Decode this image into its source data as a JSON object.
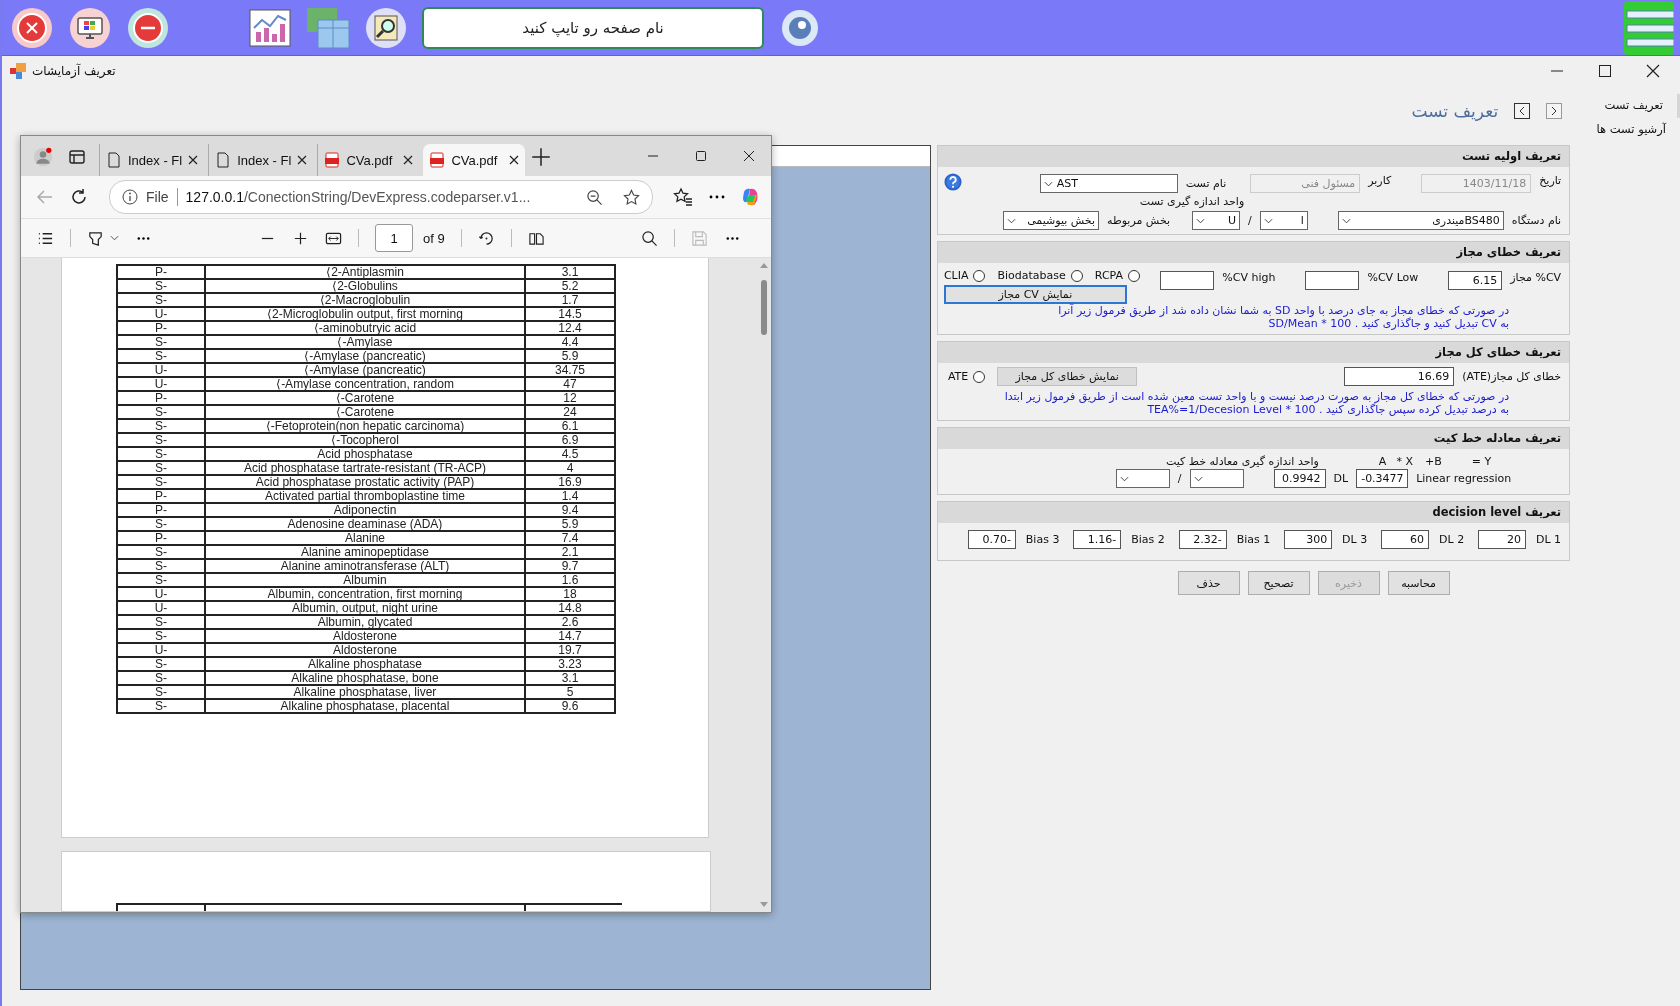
{
  "top_bar": {
    "search": {
      "placeholder": "نام صفحه رو تایپ کنید"
    }
  },
  "window": {
    "title": "تعریف آزمایشات"
  },
  "sidebar": {
    "items": [
      {
        "label": "تعریف تست",
        "selected": true
      },
      {
        "label": "آرشیو تست ها",
        "selected": false
      }
    ]
  },
  "page_title": "تعریف تست",
  "browser": {
    "tabs": [
      {
        "label": "Index - Fl",
        "kind": "page",
        "selected": false
      },
      {
        "label": "Index - Fl",
        "kind": "page",
        "selected": false
      },
      {
        "label": "CVa.pdf",
        "kind": "pdf",
        "selected": false
      },
      {
        "label": "CVa.pdf",
        "kind": "pdf",
        "selected": true
      }
    ],
    "address": {
      "scheme": "File",
      "host": "127.0.0.1",
      "path": "/ConectionString/DevExpress.codeparser.v1..."
    },
    "pdf_toolbar": {
      "page": "1",
      "page_count": "of 9"
    },
    "table": {
      "rows": [
        {
          "type": "P-",
          "name": "⟨2-Antiplasmin",
          "value": "3.1"
        },
        {
          "type": "S-",
          "name": "⟨2-Globulins",
          "value": "5.2"
        },
        {
          "type": "S-",
          "name": "⟨2-Macroglobulin",
          "value": "1.7"
        },
        {
          "type": "U-",
          "name": "⟨2-Microglobulin output, first morning",
          "value": "14.5"
        },
        {
          "type": "P-",
          "name": "⟨-aminobutryic acid",
          "value": "12.4"
        },
        {
          "type": "S-",
          "name": "⟨-Amylase",
          "value": "4.4"
        },
        {
          "type": "S-",
          "name": "⟨-Amylase (pancreatic)",
          "value": "5.9"
        },
        {
          "type": "U-",
          "name": "⟨-Amylase (pancreatic)",
          "value": "34.75"
        },
        {
          "type": "U-",
          "name": "⟨-Amylase concentration, random",
          "value": "47"
        },
        {
          "type": "P-",
          "name": "⟨-Carotene",
          "value": "12"
        },
        {
          "type": "S-",
          "name": "⟨-Carotene",
          "value": "24"
        },
        {
          "type": "S-",
          "name": "⟨-Fetoprotein(non hepatic carcinoma)",
          "value": "6.1"
        },
        {
          "type": "S-",
          "name": "⟨-Tocopherol",
          "value": "6.9"
        },
        {
          "type": "S-",
          "name": "Acid phosphatase",
          "value": "4.5"
        },
        {
          "type": "S-",
          "name": "Acid phosphatase tartrate-resistant (TR-ACP)",
          "value": "4"
        },
        {
          "type": "S-",
          "name": "Acid phosphatase prostatic activity (PAP)",
          "value": "16.9"
        },
        {
          "type": "P-",
          "name": "Activated partial thromboplastine time",
          "value": "1.4"
        },
        {
          "type": "P-",
          "name": "Adiponectin",
          "value": "9.4"
        },
        {
          "type": "S-",
          "name": "Adenosine deaminase (ADA)",
          "value": "5.9"
        },
        {
          "type": "P-",
          "name": "Alanine",
          "value": "7.4"
        },
        {
          "type": "S-",
          "name": "Alanine aminopeptidase",
          "value": "2.1"
        },
        {
          "type": "S-",
          "name": "Alanine aminotransferase (ALT)",
          "value": "9.7"
        },
        {
          "type": "S-",
          "name": "Albumin",
          "value": "1.6"
        },
        {
          "type": "U-",
          "name": "Albumin, concentration, first morning",
          "value": "18"
        },
        {
          "type": "U-",
          "name": "Albumin, output, night urine",
          "value": "14.8"
        },
        {
          "type": "S-",
          "name": "Albumin, glycated",
          "value": "2.6"
        },
        {
          "type": "S-",
          "name": "Aldosterone",
          "value": "14.7"
        },
        {
          "type": "U-",
          "name": "Aldosterone",
          "value": "19.7"
        },
        {
          "type": "S-",
          "name": "Alkaline phosphatase",
          "value": "3.23"
        },
        {
          "type": "S-",
          "name": "Alkaline phosphatase, bone",
          "value": "3.1"
        },
        {
          "type": "S-",
          "name": "Alkaline phosphatase, liver",
          "value": "5"
        },
        {
          "type": "S-",
          "name": "Alkaline phosphatase, placental",
          "value": "9.6"
        }
      ]
    }
  },
  "basic": {
    "title": "تعریف اولیه تست",
    "date": {
      "label": "تاریخ",
      "value": "1403/11/18",
      "disabled": true
    },
    "user": {
      "label": "کاربر",
      "value": "مسئول فنی",
      "disabled": true
    },
    "test_name": {
      "label": "نام تست",
      "value": "AST"
    },
    "unit_label": "واحد اندازه گیری تست",
    "device": {
      "label": "نام دستگاه",
      "value": "BS480میندری"
    },
    "unit_1": "l",
    "unit_separator": "/",
    "unit_2": "U",
    "department": {
      "label": "بخش مربوطه",
      "value": "بخش بیوشیمی"
    }
  },
  "allowed_error": {
    "title": "تعریف خطای مجاز",
    "cv": {
      "label": "CV% مجاز",
      "value": "6.15"
    },
    "cv_low_label": "CV Low%",
    "cv_high_label": "CV high%",
    "options": [
      {
        "label": "CLIA",
        "selected": false
      },
      {
        "label": "Biodatabase",
        "selected": false
      },
      {
        "label": "RCPA",
        "selected": false
      }
    ],
    "show_button": "نمایش CV مجاز",
    "note_lines": [
      "در صورتی که خطای مجاز به جای درصد با واحد SD به شما نشان داده شد از طریق فرمول زیر آنرا",
      "به CV تبدیل کنید و جاگذاری کنید .    SD/Mean * 100"
    ]
  },
  "total_error": {
    "title": "تعریف خطای کل مجاز",
    "ate": {
      "label": "خطای کل مجاز(ATE)",
      "value": "16.69"
    },
    "show_button": "نمایش خطای کل مجاز",
    "option": {
      "label": "ATE",
      "selected": false
    },
    "note_lines": [
      "در صورتی که خطای کل مجاز به صورت درصد نیست و با واحد تست معین شده است از طریق فرمول زیر ابتدا",
      "به درصد تبدیل کرده سپس جاگذاری کنید .    TEA%=1/Decesion Level * 100"
    ]
  },
  "regression": {
    "title": "تعریف معادله خط کیت",
    "formula": [
      "A",
      "* X",
      "+B",
      "= Y"
    ],
    "method": "Linear regression",
    "b": "-0.3477",
    "dl_label": "DL",
    "a": "0.9942",
    "unit_label": "واحد اندازه گیری معادله خط کیت",
    "unit_separator": "/"
  },
  "decision_level": {
    "title": "تعریف decision level",
    "fields": [
      {
        "label": "Bias 3",
        "value": "0.70-"
      },
      {
        "label": "Bias 2",
        "value": "1.16-"
      },
      {
        "label": "Bias 1",
        "value": "2.32-"
      },
      {
        "label": "DL 3",
        "value": "300"
      },
      {
        "label": "DL 2",
        "value": "60"
      },
      {
        "label": "DL 1",
        "value": "20"
      }
    ]
  },
  "buttons": [
    {
      "label": "محاسبه",
      "disabled": false
    },
    {
      "label": "ذخیره",
      "disabled": true
    },
    {
      "label": "تصحیح",
      "disabled": false
    },
    {
      "label": "حذف",
      "disabled": false
    }
  ]
}
